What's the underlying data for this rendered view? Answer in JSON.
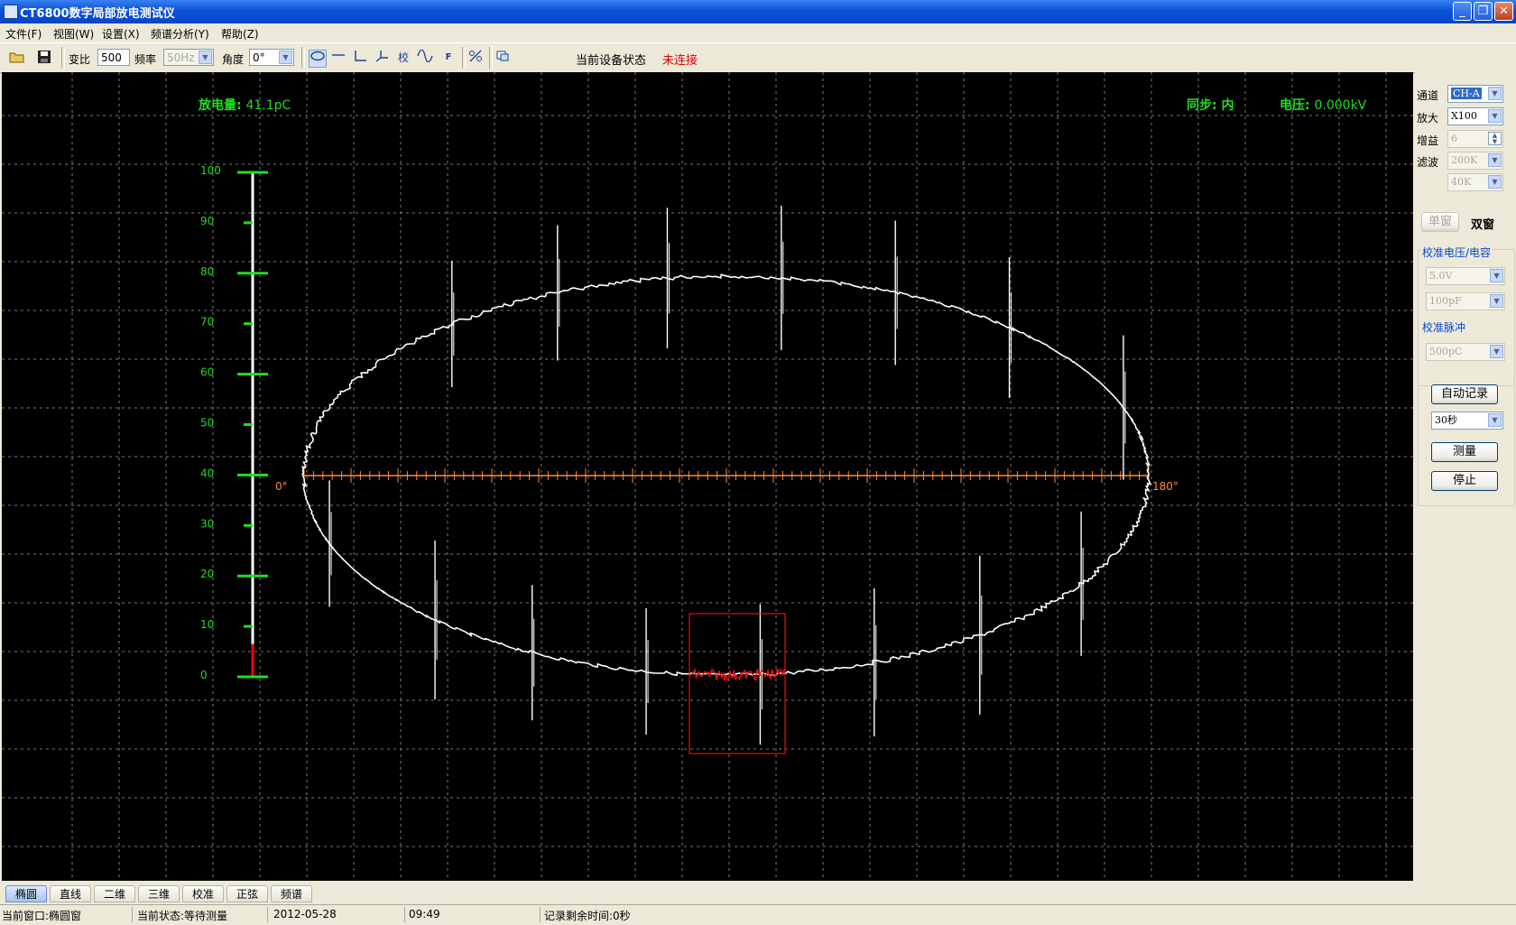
{
  "window": {
    "title": "CT6800数字局部放电测试仪"
  },
  "menu": [
    "文件(F)",
    "视图(W)",
    "设置(X)",
    "频谱分析(Y)",
    "帮助(Z)"
  ],
  "toolbar": {
    "ratio_label": "变比",
    "ratio_value": "500",
    "freq_label": "频率",
    "freq_value": "50Hz",
    "angle_label": "角度",
    "angle_value": "0°",
    "calib_glyph": "校",
    "f_glyph": "F",
    "device_status_label": "当前设备状态",
    "device_status_value": "未连接"
  },
  "display": {
    "discharge_label": "放电量:",
    "discharge_value": "41.1pC",
    "sync_label": "同步:",
    "sync_value": "内",
    "voltage_label": "电压:",
    "voltage_value": "0.000kV",
    "phase_start": "0°",
    "phase_end": "180°",
    "scale_ticks": [
      "100",
      "90",
      "80",
      "70",
      "60",
      "50",
      "40",
      "30",
      "20",
      "10",
      "0"
    ],
    "bar_level_percent": 6.5,
    "colors": {
      "background": "#000000",
      "trace": "#ffffff",
      "axis": "#ff8c3a",
      "scale": "#22dd22",
      "window": "#e01010"
    }
  },
  "panel": {
    "channel_label": "通道",
    "channel_value": "CH-A",
    "amp_label": "放大",
    "amp_value": "X100",
    "gain_label": "增益",
    "gain_value": "6",
    "filter_label": "滤波",
    "filter_high": "200K",
    "filter_low": "40K",
    "single_window": "单窗",
    "dual_window": "双窗",
    "calib_group": "校准电压/电容",
    "calib_voltage": "5.0V",
    "calib_cap": "100pF",
    "pulse_group": "校准脉冲",
    "pulse_value": "500pC",
    "auto_record": "自动记录",
    "record_time": "30秒",
    "measure": "测量",
    "stop": "停止"
  },
  "tabs": [
    "椭圆",
    "直线",
    "二维",
    "三维",
    "校准",
    "正弦",
    "频谱"
  ],
  "statusbar": {
    "window": "当前窗口:椭圆窗",
    "state": "当前状态:等待测量",
    "date": "2012-05-28",
    "time": "09:49",
    "remaining": "记录剩余时间:0秒"
  }
}
